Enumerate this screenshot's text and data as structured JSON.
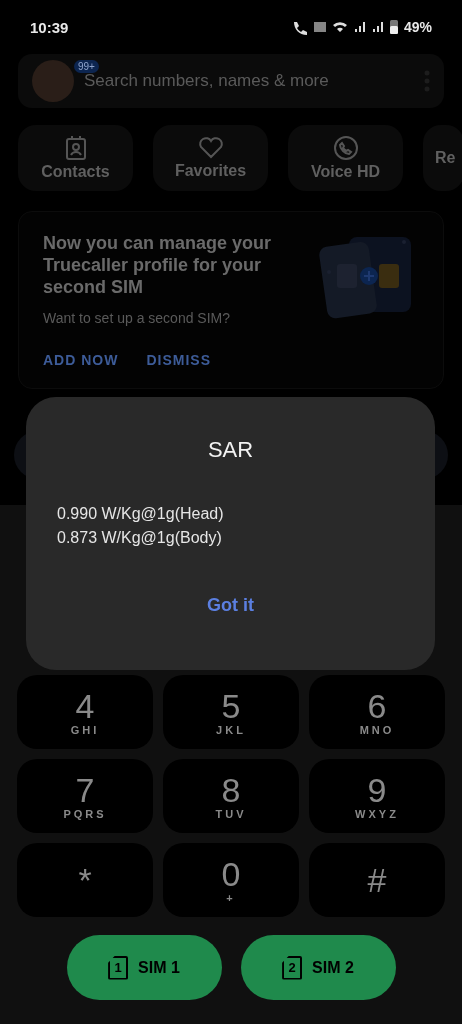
{
  "status_bar": {
    "time": "10:39",
    "battery": "49%"
  },
  "search": {
    "placeholder": "Search numbers, names & more",
    "badge": "99+"
  },
  "quick_actions": [
    {
      "kind": "contacts",
      "label": "Contacts"
    },
    {
      "kind": "favorites",
      "label": "Favorites"
    },
    {
      "kind": "voice",
      "label": "Voice HD"
    },
    {
      "kind": "other",
      "label": "Re"
    }
  ],
  "promo": {
    "title": "Now you can manage your Truecaller profile for your second SIM",
    "subtitle": "Want to set up a second SIM?",
    "actions": [
      "ADD NOW",
      "DISMISS"
    ]
  },
  "dialog": {
    "title": "SAR",
    "lines": [
      "0.990 W/Kg@1g(Head)",
      "0.873 W/Kg@1g(Body)"
    ],
    "button": "Got it"
  },
  "keypad": [
    [
      {
        "digit": "4",
        "letters": "GHI"
      },
      {
        "digit": "5",
        "letters": "JKL"
      },
      {
        "digit": "6",
        "letters": "MNO"
      }
    ],
    [
      {
        "digit": "7",
        "letters": "PQRS"
      },
      {
        "digit": "8",
        "letters": "TUV"
      },
      {
        "digit": "9",
        "letters": "WXYZ"
      }
    ],
    [
      {
        "digit": "*"
      },
      {
        "digit": "0",
        "letters": "+"
      },
      {
        "digit": "#"
      }
    ]
  ],
  "sim_buttons": [
    {
      "number": "1",
      "label": "SIM 1"
    },
    {
      "number": "2",
      "label": "SIM 2"
    }
  ]
}
